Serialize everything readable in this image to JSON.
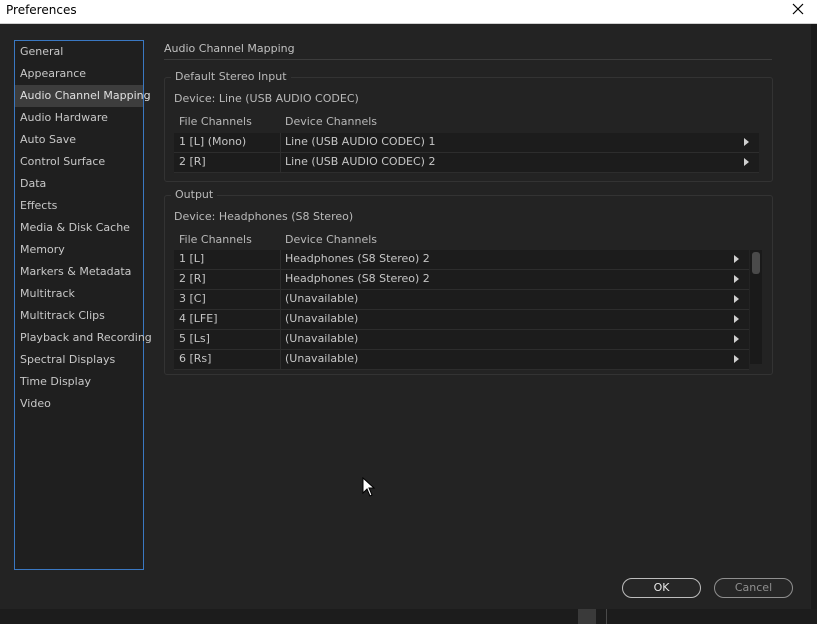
{
  "window": {
    "title": "Preferences",
    "close_icon": "close-icon"
  },
  "sidebar": {
    "items": [
      {
        "label": "General"
      },
      {
        "label": "Appearance"
      },
      {
        "label": "Audio Channel Mapping",
        "active": true
      },
      {
        "label": "Audio Hardware"
      },
      {
        "label": "Auto Save"
      },
      {
        "label": "Control Surface"
      },
      {
        "label": "Data"
      },
      {
        "label": "Effects"
      },
      {
        "label": "Media & Disk Cache"
      },
      {
        "label": "Memory"
      },
      {
        "label": "Markers & Metadata"
      },
      {
        "label": "Multitrack"
      },
      {
        "label": "Multitrack Clips"
      },
      {
        "label": "Playback and Recording"
      },
      {
        "label": "Spectral Displays"
      },
      {
        "label": "Time Display"
      },
      {
        "label": "Video"
      }
    ]
  },
  "main": {
    "title": "Audio Channel Mapping",
    "input": {
      "legend": "Default Stereo Input",
      "device": "Device: Line (USB AUDIO  CODEC)",
      "col_file": "File Channels",
      "col_device": "Device Channels",
      "rows": [
        {
          "file": "1 [L] (Mono)",
          "device": "Line (USB AUDIO  CODEC) 1"
        },
        {
          "file": "2 [R]",
          "device": "Line (USB AUDIO  CODEC) 2"
        }
      ]
    },
    "output": {
      "legend": "Output",
      "device": "Device: Headphones (S8 Stereo)",
      "col_file": "File Channels",
      "col_device": "Device Channels",
      "rows": [
        {
          "file": "1 [L]",
          "device": "Headphones (S8 Stereo) 2"
        },
        {
          "file": "2 [R]",
          "device": "Headphones (S8 Stereo) 2"
        },
        {
          "file": "3 [C]",
          "device": "(Unavailable)"
        },
        {
          "file": "4 [LFE]",
          "device": "(Unavailable)"
        },
        {
          "file": "5 [Ls]",
          "device": "(Unavailable)"
        },
        {
          "file": "6 [Rs]",
          "device": "(Unavailable)"
        }
      ]
    }
  },
  "buttons": {
    "ok": "OK",
    "cancel": "Cancel"
  },
  "colors": {
    "accent_border": "#3a78c2",
    "background": "#232323",
    "selected_item": "#3d3d3d"
  }
}
